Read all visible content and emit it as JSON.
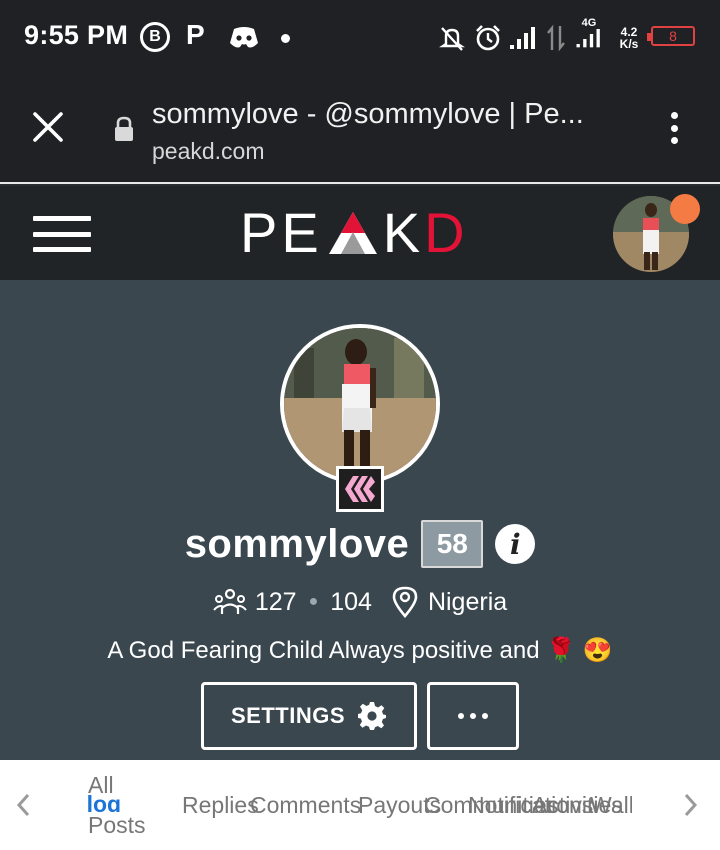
{
  "status_bar": {
    "time": "9:55 PM",
    "icons": [
      "b-icon",
      "p-icon",
      "discord-icon",
      "dot",
      "mute-icon",
      "alarm-icon",
      "signal-icon",
      "data-arrows-icon",
      "signal-4g-icon"
    ],
    "network_type": "4G",
    "speed_value": "4.2",
    "speed_unit": "K/s",
    "battery": "8",
    "battery_color": "#e24141"
  },
  "browser": {
    "page_title": "sommylove - @sommylove | Pe...",
    "domain": "peakd.com"
  },
  "app_header": {
    "logo_left": "PE",
    "logo_right_k": "K",
    "logo_right_d": "D",
    "brand_red": "#e31337",
    "notification_color": "#f47b44"
  },
  "profile": {
    "username": "sommylove",
    "reputation": "58",
    "followers": "127",
    "following": "104",
    "location": "Nigeria",
    "about": "A God Fearing Child Always positive and 🌹 😍",
    "settings_label": "SETTINGS",
    "background_color": "#3a474f"
  },
  "tabs": {
    "items": [
      {
        "label": "Replies"
      },
      {
        "label": "Comments"
      },
      {
        "label": "Payouts"
      },
      {
        "label": "Communities"
      },
      {
        "label": "Notifications"
      },
      {
        "label": "Activities"
      },
      {
        "label": "Wallet"
      }
    ],
    "blog_line1": "All",
    "blog_active": "Blog",
    "blog_line3": "Posts",
    "active_color": "#1b74d8"
  }
}
